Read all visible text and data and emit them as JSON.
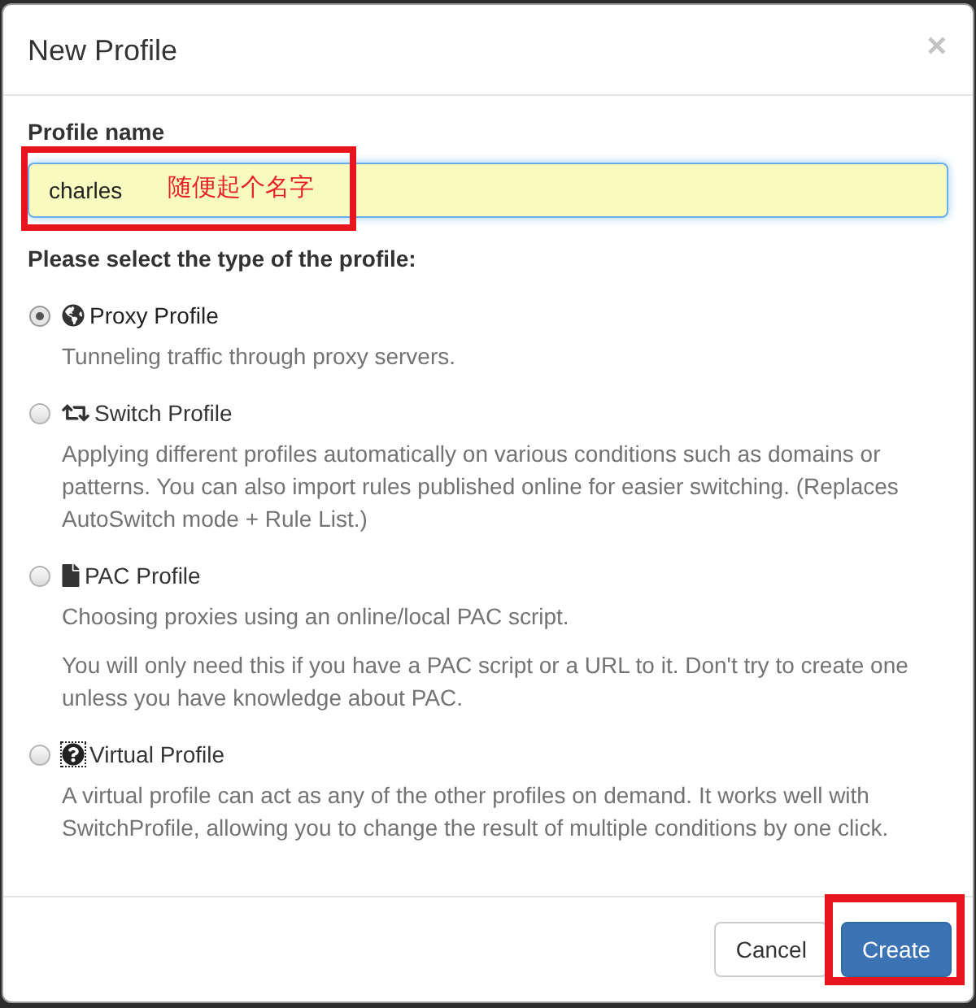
{
  "dialog": {
    "title": "New Profile",
    "close_label": "×"
  },
  "name_field": {
    "label": "Profile name",
    "value": "charles",
    "annotation": "随便起个名字",
    "highlighted": true
  },
  "type_prompt": "Please select the type of the profile:",
  "profile_types": [
    {
      "kind": "proxy",
      "label": "Proxy Profile",
      "selected": true,
      "focused": false,
      "descriptions": [
        "Tunneling traffic through proxy servers."
      ]
    },
    {
      "kind": "switch",
      "label": "Switch Profile",
      "selected": false,
      "focused": false,
      "descriptions": [
        "Applying different profiles automatically on various conditions such as domains or patterns. You can also import rules published online for easier switching. (Replaces AutoSwitch mode + Rule List.)"
      ]
    },
    {
      "kind": "pac",
      "label": "PAC Profile",
      "selected": false,
      "focused": false,
      "descriptions": [
        "Choosing proxies using an online/local PAC script.",
        "You will only need this if you have a PAC script or a URL to it. Don't try to create one unless you have knowledge about PAC."
      ]
    },
    {
      "kind": "virtual",
      "label": "Virtual Profile",
      "selected": false,
      "focused": true,
      "descriptions": [
        "A virtual profile can act as any of the other profiles on demand. It works well with SwitchProfile, allowing you to change the result of multiple conditions by one click."
      ]
    }
  ],
  "buttons": [
    {
      "kind": "default",
      "label": "Cancel",
      "highlighted": false
    },
    {
      "kind": "primary",
      "label": "Create",
      "highlighted": true
    }
  ]
}
